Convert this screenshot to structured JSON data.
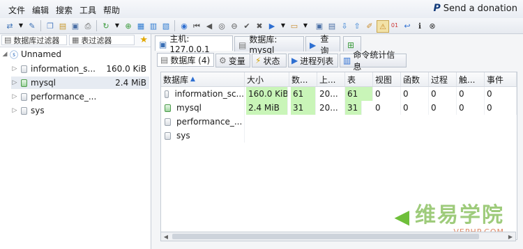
{
  "menu": [
    "文件",
    "编辑",
    "搜索",
    "工具",
    "帮助"
  ],
  "donation": {
    "label": "Send a donation",
    "icon": "paypal-icon"
  },
  "toolbar_icons": [
    "connect-icon",
    "dropdown-icon",
    "edit-icon",
    "copy-icon",
    "paste-icon",
    "save-icon",
    "print-icon",
    "refresh-icon",
    "dropdown-icon",
    "new-db-icon",
    "add-table-icon",
    "add-view-icon",
    "add-proc-icon",
    "help-icon",
    "first-icon",
    "prev-icon",
    "stop-icon",
    "minus-icon",
    "check-icon",
    "close-icon",
    "run-icon",
    "dropdown-icon",
    "query-icon",
    "dropdown-icon",
    "save-query-icon",
    "load-query-icon",
    "import-icon",
    "export-icon",
    "note-icon",
    "warning-icon",
    "binary-icon",
    "wrap-icon",
    "info-icon",
    "cancel-icon"
  ],
  "left": {
    "filter_db": "数据库过滤器",
    "filter_table": "表过滤器",
    "tree_root": "Unnamed",
    "databases": [
      {
        "name": "information_s...",
        "size": "160.0 KiB"
      },
      {
        "name": "mysql",
        "size": "2.4 MiB"
      },
      {
        "name": "performance_...",
        "size": ""
      },
      {
        "name": "sys",
        "size": ""
      }
    ]
  },
  "tabs": [
    {
      "label": "主机: 127.0.0.1"
    },
    {
      "label": "数据库: mysql"
    },
    {
      "label": "查询"
    }
  ],
  "subtabs": [
    {
      "label": "数据库 (4)"
    },
    {
      "label": "变量"
    },
    {
      "label": "状态"
    },
    {
      "label": "进程列表"
    },
    {
      "label": "命令统计信息"
    }
  ],
  "grid": {
    "headers": [
      "数据库",
      "大小",
      "数...",
      "上...",
      "表",
      "视图",
      "函数",
      "过程",
      "触...",
      "事件"
    ],
    "sort_icon": "sort-asc-icon",
    "rows": [
      {
        "name": "information_sc...",
        "cells": [
          "160.0 KiB",
          "61",
          "20...",
          "61",
          "0",
          "0",
          "0",
          "0",
          "0"
        ]
      },
      {
        "name": "mysql",
        "cells": [
          "2.4 MiB",
          "31",
          "20...",
          "31",
          "0",
          "0",
          "0",
          "0",
          "0"
        ]
      },
      {
        "name": "performance_...",
        "cells": [
          "",
          "",
          "",
          "",
          "",
          "",
          "",
          "",
          ""
        ]
      },
      {
        "name": "sys",
        "cells": [
          "",
          "",
          "",
          "",
          "",
          "",
          "",
          "",
          ""
        ]
      }
    ]
  },
  "watermark": {
    "text": "维易学院",
    "sub": "VEPHP.COM"
  }
}
